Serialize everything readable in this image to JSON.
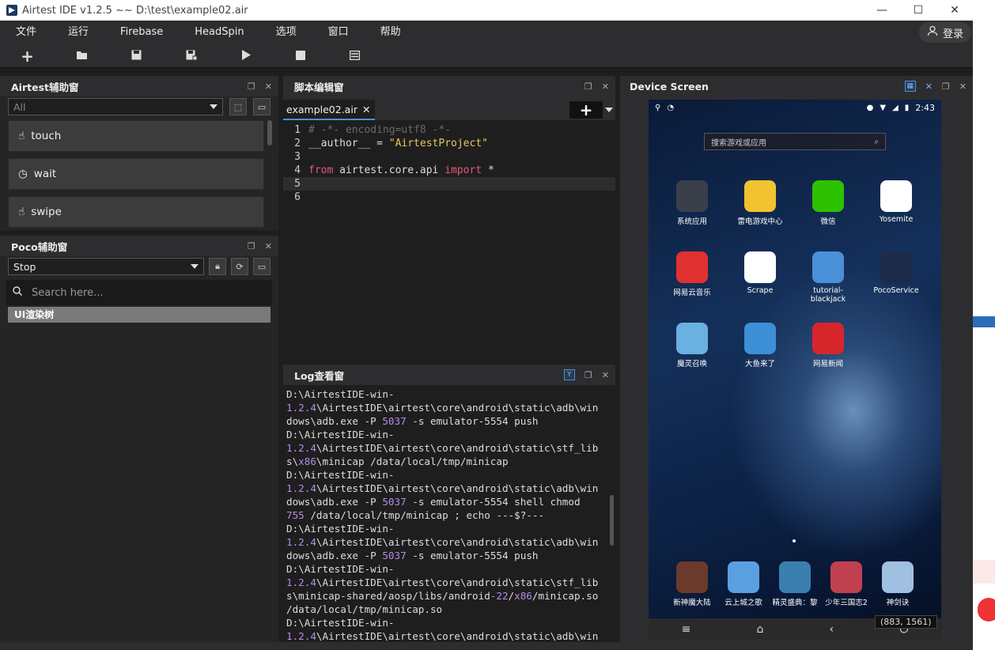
{
  "window": {
    "title": "Airtest IDE v1.2.5 ~~ D:\\test\\example02.air",
    "min": "—",
    "max": "☐",
    "close": "✕"
  },
  "menu": [
    "文件",
    "运行",
    "Firebase",
    "HeadSpin",
    "选项",
    "窗口",
    "帮助"
  ],
  "login": "登录",
  "airtest_panel": {
    "title": "Airtest辅助窗",
    "filter": "All",
    "apis": [
      "touch",
      "wait",
      "swipe"
    ]
  },
  "poco_panel": {
    "title": "Poco辅助窗",
    "mode": "Stop",
    "search_placeholder": "Search here...",
    "tree_root": "UI渲染树"
  },
  "editor": {
    "title": "脚本编辑窗",
    "tab": "example02.air",
    "lines": [
      {
        "num": "1",
        "text": "# -*- encoding=utf8 -*-"
      },
      {
        "num": "2",
        "text": "__author__ = \"AirtestProject\""
      },
      {
        "num": "3",
        "text": ""
      },
      {
        "num": "4",
        "text": "from airtest.core.api import *"
      },
      {
        "num": "5",
        "text": ""
      },
      {
        "num": "6",
        "text": ""
      }
    ]
  },
  "log": {
    "title": "Log查看窗",
    "lines": [
      "D:\\AirtestIDE-win-",
      "1.2.4\\AirtestIDE\\airtest\\core\\android\\static\\adb\\win",
      "dows\\adb.exe -P 5037 -s emulator-5554 push",
      "D:\\AirtestIDE-win-",
      "1.2.4\\AirtestIDE\\airtest\\core\\android\\static\\stf_lib",
      "s\\x86\\minicap /data/local/tmp/minicap",
      "D:\\AirtestIDE-win-",
      "1.2.4\\AirtestIDE\\airtest\\core\\android\\static\\adb\\win",
      "dows\\adb.exe -P 5037 -s emulator-5554 shell chmod",
      "755 /data/local/tmp/minicap ; echo ---$?---",
      "D:\\AirtestIDE-win-",
      "1.2.4\\AirtestIDE\\airtest\\core\\android\\static\\adb\\win",
      "dows\\adb.exe -P 5037 -s emulator-5554 push",
      "D:\\AirtestIDE-win-",
      "1.2.4\\AirtestIDE\\airtest\\core\\android\\static\\stf_lib",
      "s\\minicap-shared/aosp/libs/android-22/x86/minicap.so",
      "/data/local/tmp/minicap.so",
      "D:\\AirtestIDE-win-",
      "1.2.4\\AirtestIDE\\airtest\\core\\android\\static\\adb\\win"
    ]
  },
  "device": {
    "title": "Device Screen",
    "time": "2:43",
    "search_placeholder": "搜索游戏或应用",
    "coords": "(883, 1561)",
    "apps": [
      {
        "label": "系统应用",
        "color": "#3a3f4a"
      },
      {
        "label": "雷电游戏中心",
        "color": "#f2c230"
      },
      {
        "label": "微信",
        "color": "#2dc100"
      },
      {
        "label": "Yosemite",
        "color": "#ffffff"
      },
      {
        "label": "网易云音乐",
        "color": "#e03131"
      },
      {
        "label": "Scrape",
        "color": "#ffffff"
      },
      {
        "label": "tutorial-blackjack",
        "color": "#4a90d9"
      },
      {
        "label": "PocoService",
        "color": "#1e2a4a"
      },
      {
        "label": "魔灵召唤",
        "color": "#6ab0e0"
      },
      {
        "label": "大鱼来了",
        "color": "#3d8fd6"
      },
      {
        "label": "网易新闻",
        "color": "#d6262b"
      }
    ],
    "dock": [
      {
        "label": "新神魔大陆",
        "color": "#6b3a2a"
      },
      {
        "label": "云上城之歌",
        "color": "#5aa0e0"
      },
      {
        "label": "精灵盛典：黎",
        "color": "#3b7fb0"
      },
      {
        "label": "少年三国志2",
        "color": "#c04050"
      },
      {
        "label": "神剑诀",
        "color": "#9fc0e0"
      }
    ]
  }
}
